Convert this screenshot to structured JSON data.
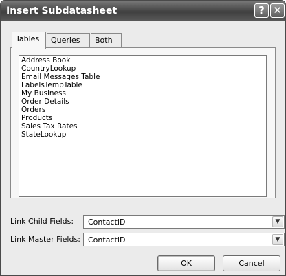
{
  "window": {
    "title": "Insert Subdatasheet",
    "help_glyph": "?",
    "close_glyph": "✕"
  },
  "tabs": [
    {
      "label": "Tables",
      "active": true
    },
    {
      "label": "Queries",
      "active": false
    },
    {
      "label": "Both",
      "active": false
    }
  ],
  "table_list": [
    "Address Book",
    "CountryLookup",
    "Email Messages Table",
    "LabelsTempTable",
    "My Business",
    "Order Details",
    "Orders",
    "Products",
    "Sales Tax Rates",
    "StateLookup"
  ],
  "link_child": {
    "label": "Link Child Fields:",
    "value": "ContactID"
  },
  "link_master": {
    "label": "Link Master Fields:",
    "value": "ContactID"
  },
  "buttons": {
    "ok": "OK",
    "cancel": "Cancel"
  },
  "dropdown_glyph": "▼"
}
